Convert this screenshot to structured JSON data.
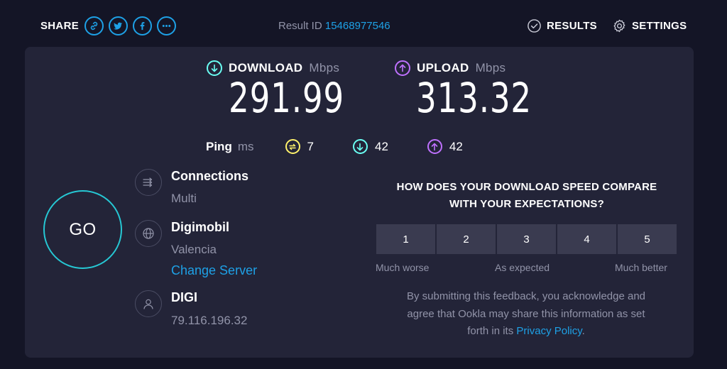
{
  "header": {
    "share_label": "SHARE",
    "share_icons": [
      "link-icon",
      "twitter-icon",
      "facebook-icon",
      "more-icon"
    ],
    "result_id_label": "Result ID",
    "result_id": "15468977546",
    "results_label": "RESULTS",
    "settings_label": "SETTINGS"
  },
  "metrics": {
    "download": {
      "label": "DOWNLOAD",
      "unit": "Mbps",
      "value": "291.99",
      "color": "#6afff3"
    },
    "upload": {
      "label": "UPLOAD",
      "unit": "Mbps",
      "value": "313.32",
      "color": "#bf71ff"
    }
  },
  "ping": {
    "label": "Ping",
    "unit": "ms",
    "idle": "7",
    "download": "42",
    "upload": "42",
    "idle_color": "#fff26b"
  },
  "go_label": "GO",
  "connections": {
    "title": "Connections",
    "value": "Multi"
  },
  "server": {
    "name": "Digimobil",
    "location": "Valencia",
    "change_label": "Change Server"
  },
  "isp": {
    "name": "DIGI",
    "ip": "79.116.196.32"
  },
  "survey": {
    "question_line1": "HOW DOES YOUR DOWNLOAD SPEED COMPARE",
    "question_line2": "WITH YOUR EXPECTATIONS?",
    "options": [
      "1",
      "2",
      "3",
      "4",
      "5"
    ],
    "label_low": "Much worse",
    "label_mid": "As expected",
    "label_high": "Much better",
    "disclaimer_line1": "By submitting this feedback, you acknowledge and",
    "disclaimer_line2": "agree that Ookla may share this information as set",
    "disclaimer_prefix": "forth in its ",
    "privacy_link": "Privacy Policy",
    "disclaimer_suffix": "."
  },
  "colors": {
    "background": "#141526",
    "panel": "#232438",
    "accent": "#1ea1e6",
    "go_ring": "#26c8d4"
  }
}
